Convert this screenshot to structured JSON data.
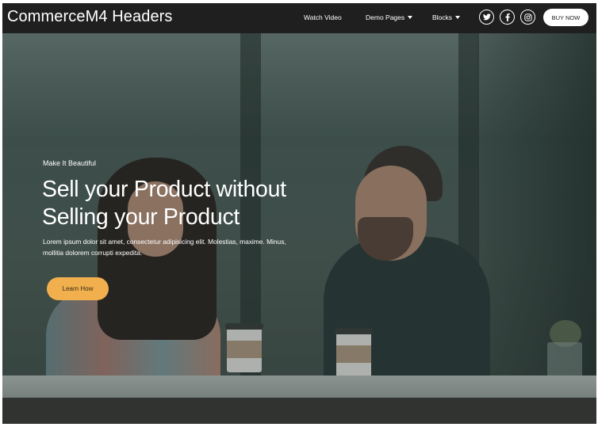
{
  "navbar": {
    "brand": "CommerceM4 Headers",
    "links": [
      {
        "label": "Watch Video",
        "has_dropdown": false
      },
      {
        "label": "Demo Pages",
        "has_dropdown": true
      },
      {
        "label": "Blocks",
        "has_dropdown": true
      }
    ],
    "social": [
      "twitter-icon",
      "facebook-icon",
      "instagram-icon"
    ],
    "buy_label": "BUY NOW"
  },
  "hero": {
    "eyebrow": "Make It Beautiful",
    "headline_line1": "Sell your Product without",
    "headline_line2": "Selling your Product",
    "subtext": "Lorem ipsum dolor sit amet, consectetur adipisicing elit. Molestias, maxime. Minus, mollitia dolorem corrupti expedita.",
    "cta_label": "Learn How"
  },
  "colors": {
    "navbar_bg": "#1f1f1f",
    "cta_bg": "#f1b04d",
    "text": "#ffffff"
  }
}
